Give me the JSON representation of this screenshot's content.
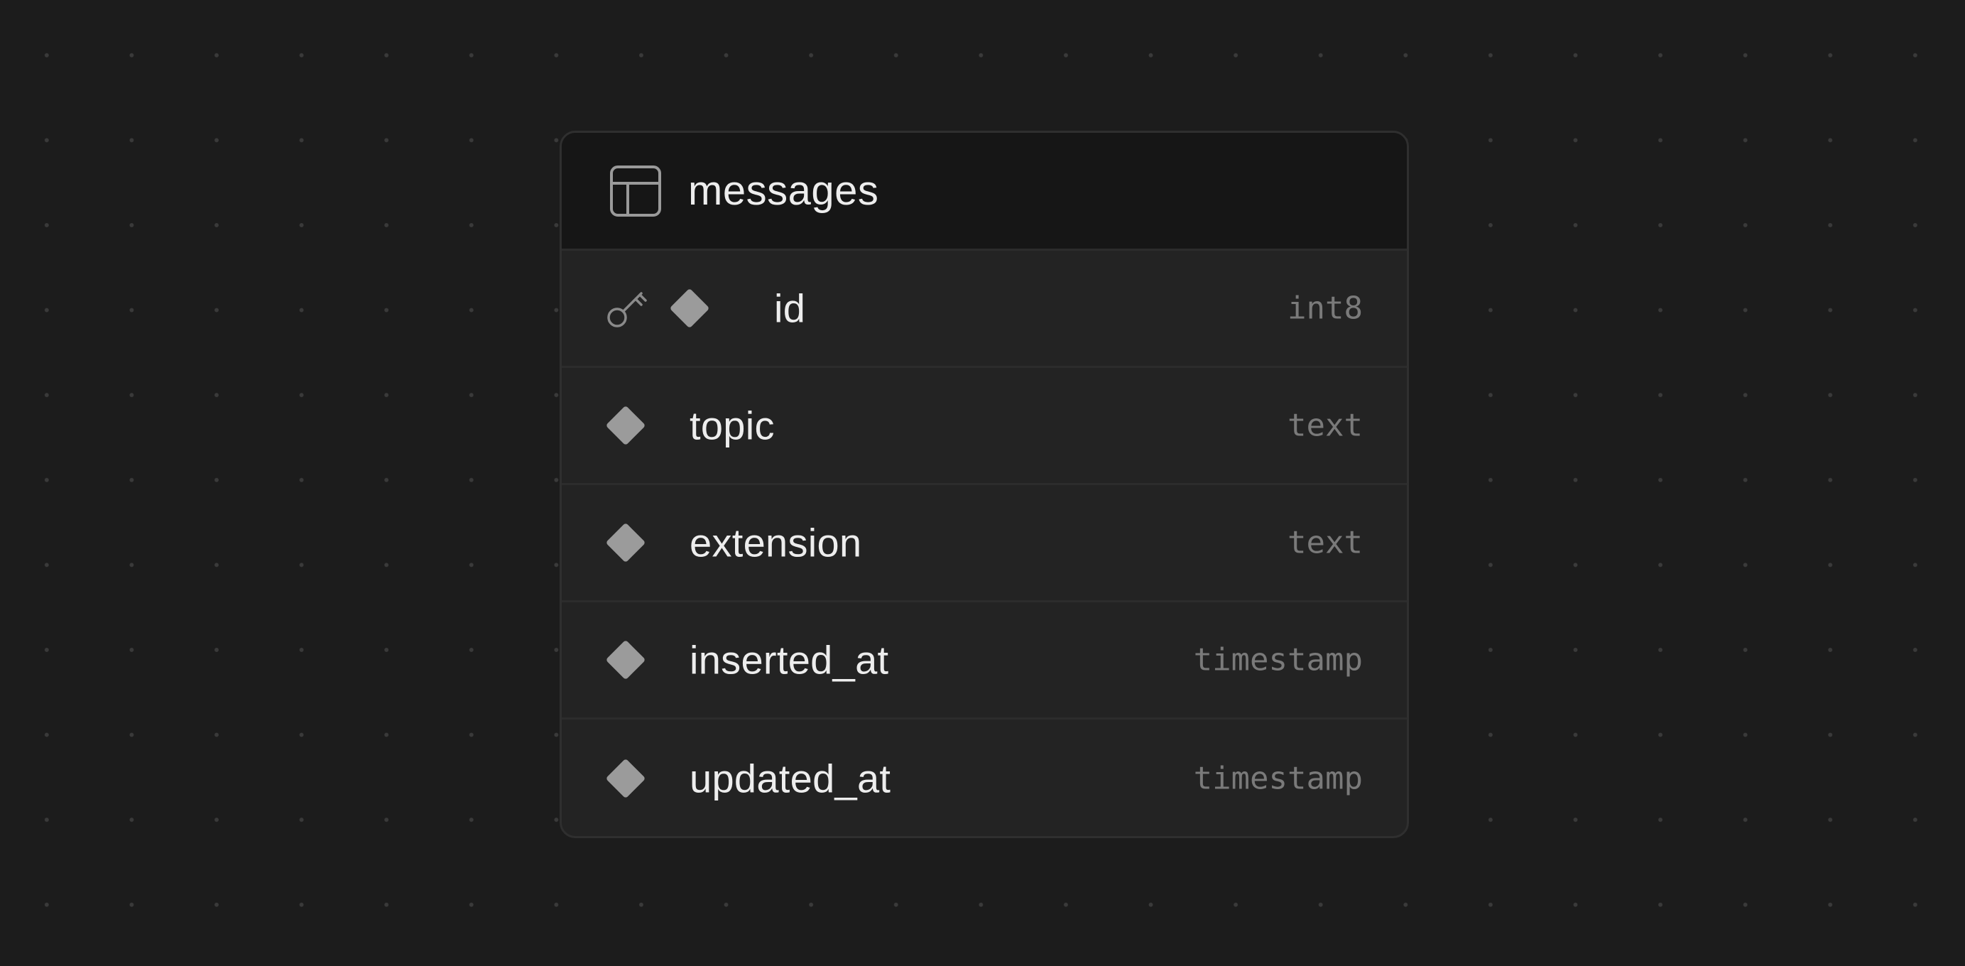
{
  "table": {
    "name": "messages",
    "icon": "table-icon",
    "columns": [
      {
        "name": "id",
        "type": "int8",
        "primary_key": true
      },
      {
        "name": "topic",
        "type": "text",
        "primary_key": false
      },
      {
        "name": "extension",
        "type": "text",
        "primary_key": false
      },
      {
        "name": "inserted_at",
        "type": "timestamp",
        "primary_key": false
      },
      {
        "name": "updated_at",
        "type": "timestamp",
        "primary_key": false
      }
    ]
  },
  "colors": {
    "canvas_background": "#1c1c1c",
    "header_background": "#161616",
    "row_background": "#232323",
    "column_marker": "#9b9b9b",
    "text_primary": "#ededed",
    "text_muted": "#7a7a7a"
  }
}
